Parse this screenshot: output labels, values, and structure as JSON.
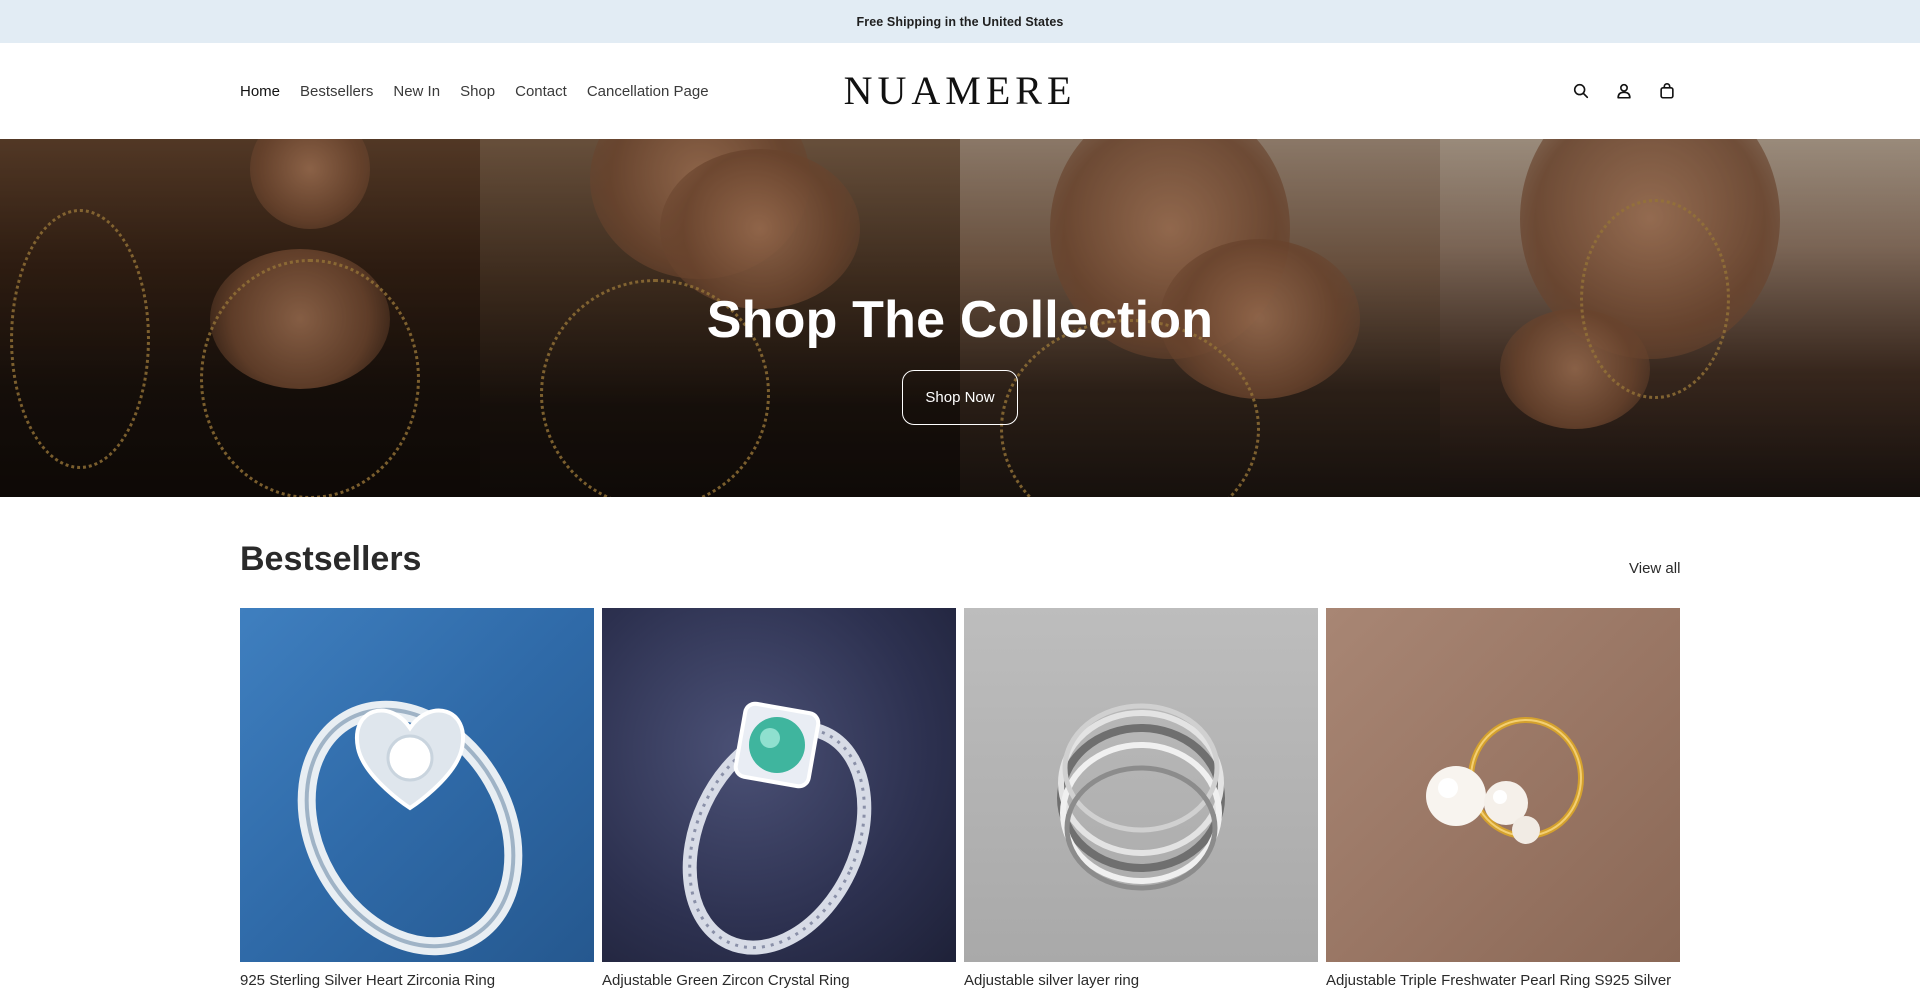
{
  "announcement": "Free Shipping in the United States",
  "header": {
    "logo": "NUAMERE",
    "nav": [
      {
        "label": "Home"
      },
      {
        "label": "Bestsellers"
      },
      {
        "label": "New In"
      },
      {
        "label": "Shop"
      },
      {
        "label": "Contact"
      },
      {
        "label": "Cancellation Page"
      }
    ],
    "icons": [
      "search-icon",
      "account-icon",
      "cart-icon"
    ]
  },
  "hero": {
    "title": "Shop The Collection",
    "button": "Shop Now"
  },
  "bestsellers": {
    "title": "Bestsellers",
    "view_all": "View all",
    "products": [
      {
        "title": "925 Sterling Silver Heart Zirconia Ring"
      },
      {
        "title": "Adjustable Green Zircon Crystal Ring"
      },
      {
        "title": "Adjustable silver layer ring"
      },
      {
        "title": "Adjustable Triple Freshwater Pearl Ring S925 Silver"
      }
    ]
  }
}
